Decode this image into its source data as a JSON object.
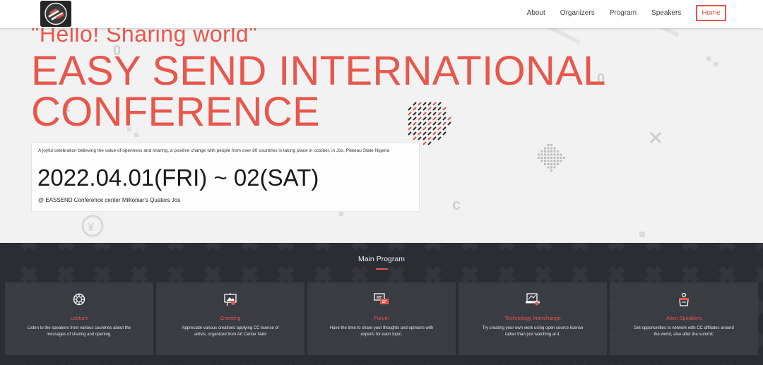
{
  "navbar": {
    "items": [
      {
        "label": "About"
      },
      {
        "label": "Organizers"
      },
      {
        "label": "Program"
      },
      {
        "label": "Speakers"
      },
      {
        "label": "Home",
        "active": true
      }
    ]
  },
  "hero": {
    "tagline": "\"Hello! Sharing world\"",
    "title_line1": "EASY SEND INTERNATIONAL",
    "title_line2": "CONFERENCE",
    "description": "A joyful celebration believing the value of openness and sharing, a positive change with people from over 80 countries is taking place in october, in Jos, Plateau State Nigeria",
    "date": "2022.04.01(FRI) ~ 02(SAT)",
    "venue": "@ EASSEND Conference center Millioniar's Quaters Jos"
  },
  "program": {
    "heading": "Main Program",
    "cards": [
      {
        "icon": "lecture-icon",
        "title": "Lecture",
        "text": "Listen to the speakers from various countries about the messages of sharing and opening."
      },
      {
        "icon": "greeting-icon",
        "title": "Greeting",
        "text": "Appreciate various creations applying CC license of artists, organized from Art Center Nabi"
      },
      {
        "icon": "forum-icon",
        "title": "Forum",
        "text": "Have the time to share your thoughts and opinions with experts for each topic."
      },
      {
        "icon": "technology-icon",
        "title": "Technology Interchange",
        "text": "Try creating your own work using open source license rather than just watching at it."
      },
      {
        "icon": "speakers-icon",
        "title": "Alien Speakers",
        "text": "Get opportunities to network with CC affiliates around the world, also after the summit."
      }
    ]
  },
  "colors": {
    "accent": "#e8574c",
    "dark_section": "#2b2d33",
    "card_bg": "#3c3e44"
  }
}
